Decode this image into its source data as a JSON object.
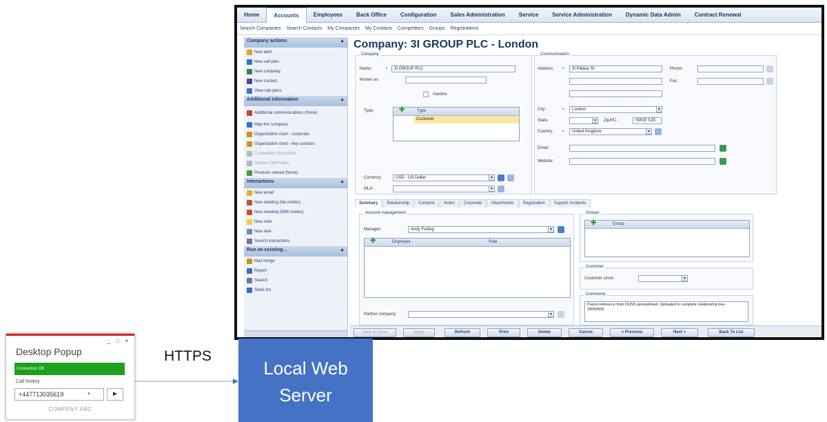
{
  "crm": {
    "menu": [
      "Home",
      "Accounts",
      "Employees",
      "Back Office",
      "Configuration",
      "Sales Administration",
      "Service",
      "Service Administration",
      "Dynamic Data Admin",
      "Contract Renewal"
    ],
    "active_menu": "Accounts",
    "submenu": [
      "Search Companies",
      "Search Contacts",
      "My Companies",
      "My Contacts",
      "Competitors",
      "Groups",
      "Registrations"
    ],
    "sidebar": {
      "company_actions": {
        "title": "Company actions",
        "items": [
          "New alert",
          "New call plan",
          "New company",
          "New contact",
          "View call plans"
        ]
      },
      "additional_information": {
        "title": "Additional information",
        "items": [
          "Additional communications (None)",
          "Map this company",
          "Organization chart - corporate",
          "Organization chart - key contacts",
          "Competitor information",
          "Partner information",
          "Products owned (None)"
        ]
      },
      "interactions": {
        "title": "Interactions",
        "items": [
          "New email",
          "New meeting (No invites)",
          "New meeting (With invites)",
          "New note",
          "New task",
          "Search interactions"
        ]
      },
      "run_existing": {
        "title": "Run an existing...",
        "items": [
          "Mail merge",
          "Report",
          "Search",
          "Static list"
        ]
      }
    },
    "company_title": "Company: 3I GROUP PLC - London",
    "company_panel": {
      "legend": "Company",
      "name_label": "Name:",
      "name_value": "3I GROUP PLC",
      "known_as_label": "Known as:",
      "inactive_label": "Inactive",
      "type_label": "Type:",
      "type_header": "Type",
      "type_value": "Customer",
      "currency_label": "Currency:",
      "currency_value": "USD - US Dollar",
      "mla_label": "MLA:"
    },
    "communication_panel": {
      "legend": "Communication",
      "address_label": "Address:",
      "address_value": "3I Palace St",
      "phone_label": "Phone:",
      "fax_label": "Fax:",
      "city_label": "City:",
      "city_value": "London",
      "state_label": "State:",
      "zip_label": "Zip/PC:",
      "zip_value": "SW1E 5JD",
      "country_label": "Country:",
      "country_value": "United Kingdom",
      "email_label": "Email:",
      "website_label": "Website:"
    },
    "tabs": [
      "Summary",
      "Relationship",
      "Contacts",
      "Notes",
      "Corporate",
      "Attachments",
      "Registration",
      "Support Incidents"
    ],
    "active_tab": "Summary",
    "account_management": {
      "legend": "Account management",
      "manager_label": "Manager:",
      "manager_value": "Andy Furling",
      "col_employee": "Employee",
      "col_role": "Role",
      "partner_label": "Partner company:"
    },
    "groups": {
      "legend": "Groups",
      "col_group": "Group"
    },
    "customer": {
      "legend": "Customer",
      "since_label": "Customer since:"
    },
    "comments": {
      "legend": "Comments",
      "text": "Parent reference from DUNS spreadsheet. Uploaded to complete relationship tree. 20050505"
    },
    "buttons": [
      "Save & Close",
      "Apply",
      "Refresh",
      "Print",
      "Delete",
      "Cancel",
      "< Previous",
      "Next >",
      "Back To List"
    ]
  },
  "popup": {
    "title": "Desktop Popup",
    "controls": "_ □ ×",
    "status": "Connection OK",
    "history_label": "Call history",
    "number": "+447713035619",
    "company": "COMPANY ABC"
  },
  "connector_label": "HTTPS",
  "server_label": "Local Web Server",
  "colors": {
    "accent": "#4472c4",
    "status_ok": "#1ea01e",
    "popup_top": "#e32020"
  }
}
